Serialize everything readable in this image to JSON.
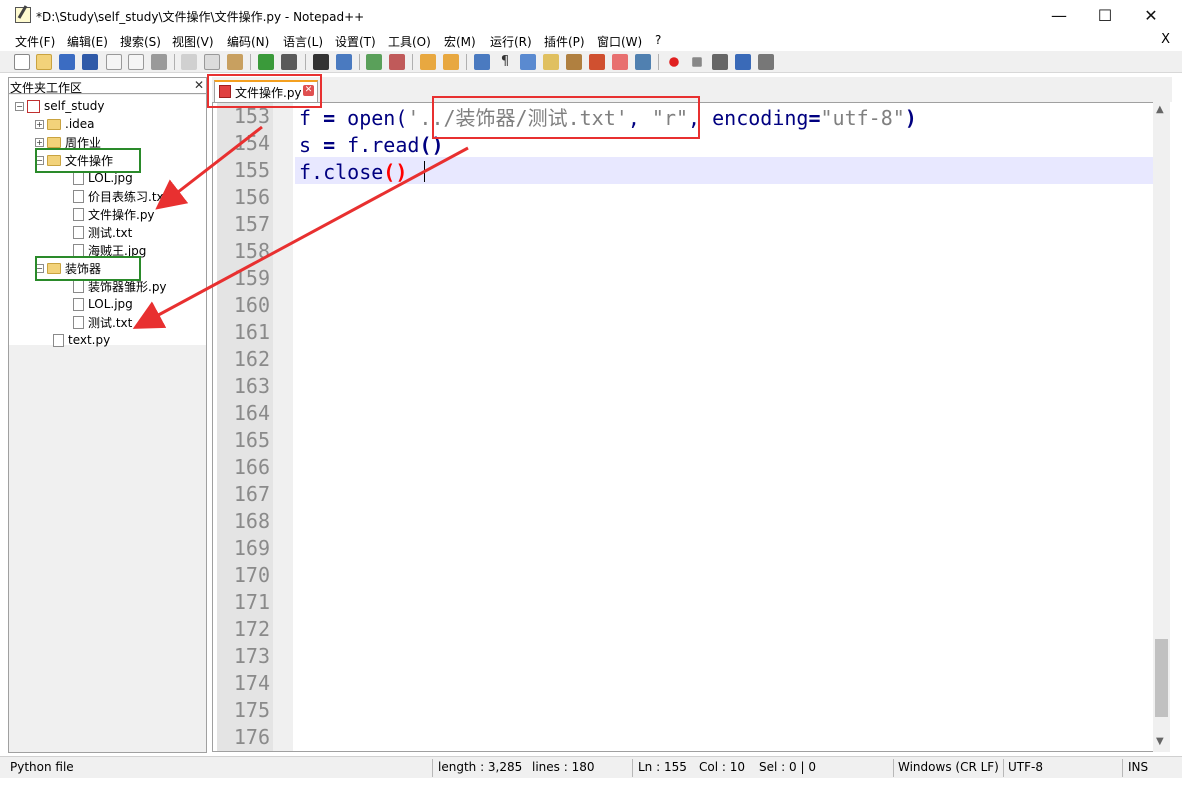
{
  "window": {
    "title": "*D:\\Study\\self_study\\文件操作\\文件操作.py - Notepad++",
    "minimize": "—",
    "maximize": "☐",
    "close": "✕"
  },
  "menu": [
    "文件(F)",
    "编辑(E)",
    "搜索(S)",
    "视图(V)",
    "编码(N)",
    "语言(L)",
    "设置(T)",
    "工具(O)",
    "宏(M)",
    "运行(R)",
    "插件(P)",
    "窗口(W)",
    "?"
  ],
  "menu_close": "X",
  "panel": {
    "title": "文件夹工作区",
    "close": "✕",
    "tree": [
      {
        "label": "self_study",
        "type": "project",
        "depth": 0,
        "expander": "−"
      },
      {
        "label": ".idea",
        "type": "folder",
        "depth": 1,
        "expander": "+"
      },
      {
        "label": "周作业",
        "type": "folder",
        "depth": 1,
        "expander": "+"
      },
      {
        "label": "文件操作",
        "type": "folder",
        "depth": 1,
        "expander": "−"
      },
      {
        "label": "LOL.jpg",
        "type": "file",
        "depth": 2
      },
      {
        "label": "价目表练习.txt",
        "type": "file",
        "depth": 2
      },
      {
        "label": "文件操作.py",
        "type": "file",
        "depth": 2
      },
      {
        "label": "测试.txt",
        "type": "file",
        "depth": 2
      },
      {
        "label": "海贼王.jpg",
        "type": "file",
        "depth": 2
      },
      {
        "label": "装饰器",
        "type": "folder",
        "depth": 1,
        "expander": "−"
      },
      {
        "label": "装饰器雏形.py",
        "type": "file",
        "depth": 2
      },
      {
        "label": "LOL.jpg",
        "type": "file",
        "depth": 2
      },
      {
        "label": "测试.txt",
        "type": "file",
        "depth": 2
      },
      {
        "label": "text.py",
        "type": "file",
        "depth": 1
      }
    ]
  },
  "tab": {
    "label": "文件操作.py",
    "close": "✕"
  },
  "editor": {
    "line_numbers": [
      "153",
      "154",
      "155",
      "156",
      "157",
      "158",
      "159",
      "160",
      "161",
      "162",
      "163",
      "164",
      "165",
      "166",
      "167",
      "168",
      "169",
      "170",
      "171",
      "172",
      "173",
      "174",
      "175",
      "176"
    ],
    "code": {
      "l1_a": "f ",
      "l1_eq": "=",
      "l1_b": " open(",
      "l1_str1": "'../装饰器/测试.txt'",
      "l1_c": ", ",
      "l1_str2": "\"r\"",
      "l1_d": ", encoding",
      "l1_eq2": "=",
      "l1_str3": "\"utf-8\"",
      "l1_e": ")",
      "l2_a": "s ",
      "l2_eq": "=",
      "l2_b": " f.read",
      "l2_p": "()",
      "l3_a": "f.close",
      "l3_p": "()"
    }
  },
  "status": {
    "filetype": "Python file",
    "length": "length : 3,285",
    "lines": "lines : 180",
    "ln": "Ln : 155",
    "col": "Col : 10",
    "sel": "Sel : 0 | 0",
    "eol": "Windows (CR LF)",
    "encoding": "UTF-8",
    "mode": "INS"
  },
  "colors": {
    "annotation_red": "#e83030",
    "annotation_green": "#2a8a2a",
    "current_line": "#e8e8ff"
  }
}
